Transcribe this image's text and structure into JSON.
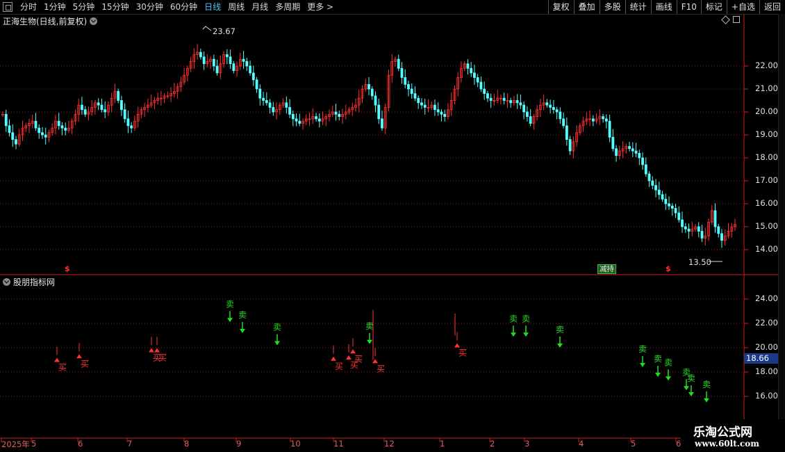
{
  "toolbar": {
    "periods": [
      "分时",
      "1分钟",
      "5分钟",
      "15分钟",
      "30分钟",
      "60分钟",
      "日线",
      "周线",
      "月线",
      "多周期",
      "更多 >"
    ],
    "active_period": "日线",
    "buttons": [
      "复权",
      "叠加",
      "多股",
      "统计",
      "画线",
      "F10",
      "标记",
      "+自选",
      "返回"
    ]
  },
  "main_panel": {
    "title": "正海生物(日线,前复权)",
    "high_label": "23.67",
    "low_label": "13.50",
    "event_tag": "减持",
    "s_marker": "$",
    "y_ticks": [
      "22.00",
      "21.00",
      "20.00",
      "19.00",
      "18.00",
      "17.00",
      "16.00",
      "15.00",
      "14.00"
    ]
  },
  "indicator_panel": {
    "title": "股朋指标网",
    "y_ticks": [
      "24.00",
      "22.00",
      "20.00",
      "18.00",
      "16.00"
    ],
    "current_value": "18.66",
    "buy_label": "买",
    "sell_label": "卖"
  },
  "date_axis": [
    "2025年",
    "5",
    "6",
    "7",
    "8",
    "9",
    "10",
    "11",
    "12",
    "1",
    "2",
    "3",
    "4",
    "5",
    "6"
  ],
  "watermark": {
    "line1": "乐淘公式网",
    "line2": "www.60lt.com"
  },
  "colors": {
    "up": "#ff3232",
    "down": "#54ffff",
    "sell": "#22dd22",
    "grid": "#8a1c1c",
    "axis": "#cc1f1f"
  },
  "price_series": [
    19.9,
    19.4,
    19.1,
    18.8,
    18.6,
    19.0,
    19.3,
    19.4,
    19.5,
    19.6,
    19.3,
    19.1,
    19.0,
    18.9,
    19.1,
    19.3,
    19.6,
    19.4,
    19.3,
    19.2,
    19.3,
    19.6,
    19.9,
    20.3,
    20.1,
    19.9,
    20.0,
    20.2,
    20.4,
    20.3,
    20.1,
    20.0,
    20.3,
    20.6,
    20.9,
    20.5,
    20.1,
    19.7,
    19.4,
    19.3,
    19.6,
    19.9,
    20.1,
    20.2,
    20.3,
    20.4,
    20.5,
    20.6,
    20.6,
    20.7,
    20.7,
    20.8,
    20.9,
    21.1,
    21.3,
    21.6,
    21.9,
    22.2,
    22.5,
    22.6,
    22.4,
    22.1,
    22.2,
    22.3,
    22.0,
    21.7,
    22.1,
    22.5,
    22.4,
    22.1,
    21.8,
    22.0,
    22.3,
    22.2,
    22.0,
    21.7,
    21.4,
    21.0,
    20.6,
    20.5,
    20.4,
    20.2,
    20.0,
    20.1,
    20.3,
    20.4,
    20.2,
    19.9,
    19.7,
    19.6,
    19.5,
    19.6,
    19.7,
    19.7,
    19.8,
    19.7,
    19.6,
    19.7,
    19.8,
    19.9,
    20.0,
    19.9,
    19.8,
    19.9,
    20.0,
    20.1,
    20.2,
    20.3,
    20.6,
    21.0,
    21.2,
    21.0,
    20.7,
    20.3,
    19.7,
    19.3,
    20.2,
    21.6,
    22.2,
    22.3,
    21.9,
    21.5,
    21.2,
    21.0,
    20.8,
    20.6,
    20.4,
    20.3,
    20.2,
    20.2,
    20.3,
    20.1,
    20.0,
    19.9,
    19.8,
    20.1,
    20.5,
    21.0,
    21.5,
    21.9,
    22.1,
    21.9,
    21.7,
    21.5,
    21.3,
    21.0,
    20.8,
    20.6,
    20.5,
    20.5,
    20.6,
    20.6,
    20.5,
    20.5,
    20.4,
    20.5,
    20.4,
    20.3,
    20.0,
    19.8,
    19.5,
    19.8,
    20.1,
    20.3,
    20.4,
    20.3,
    20.2,
    20.1,
    20.0,
    19.7,
    19.4,
    18.8,
    18.3,
    18.7,
    19.1,
    19.4,
    19.6,
    19.7,
    19.7,
    19.6,
    19.7,
    19.8,
    19.7,
    19.6,
    18.9,
    18.4,
    18.1,
    18.3,
    18.4,
    18.5,
    18.4,
    18.3,
    18.2,
    18.0,
    17.7,
    17.3,
    17.0,
    16.8,
    16.6,
    16.4,
    16.2,
    16.0,
    15.9,
    15.8,
    15.6,
    15.3,
    15.0,
    14.9,
    14.8,
    14.9,
    15.0,
    14.8,
    14.5,
    14.6,
    15.2,
    15.7,
    15.0,
    14.7,
    14.4,
    14.6,
    14.8,
    15.0,
    15.1
  ]
}
